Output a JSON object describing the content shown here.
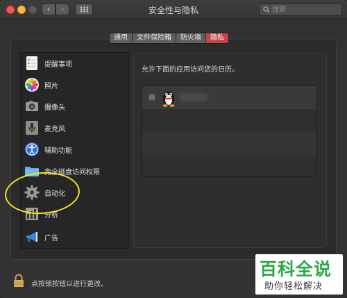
{
  "window": {
    "title": "安全性与隐私",
    "back_glyph": "‹",
    "forward_glyph": "›"
  },
  "search": {
    "placeholder": "搜索"
  },
  "tabs": [
    {
      "label": "通用",
      "active": false
    },
    {
      "label": "文件保险箱",
      "active": false
    },
    {
      "label": "防火墙",
      "active": false
    },
    {
      "label": "隐私",
      "active": true
    }
  ],
  "sidebar": {
    "items": [
      {
        "label": "提醒事项",
        "icon": "reminders-icon"
      },
      {
        "label": "照片",
        "icon": "photos-icon"
      },
      {
        "label": "摄像头",
        "icon": "camera-icon"
      },
      {
        "label": "麦克风",
        "icon": "microphone-icon"
      },
      {
        "label": "辅助功能",
        "icon": "accessibility-icon"
      },
      {
        "label": "完全磁盘访问权限",
        "icon": "folder-icon"
      },
      {
        "label": "自动化",
        "icon": "gear-icon"
      },
      {
        "label": "分析",
        "icon": "analytics-icon"
      },
      {
        "label": "广告",
        "icon": "megaphone-icon"
      }
    ]
  },
  "main": {
    "description": "允许下面的应用访问您的日历。",
    "apps": [
      {
        "icon": "qq-penguin-icon",
        "checked": false
      }
    ]
  },
  "footer": {
    "lock_text": "点按锁按钮以进行更改。"
  },
  "watermark": {
    "title": "百科全说",
    "subtitle": "助你轻松解决"
  },
  "colors": {
    "active_tab": "#c2454a",
    "annotation": "#f2e22a",
    "watermark_green": "#2aa84a"
  }
}
